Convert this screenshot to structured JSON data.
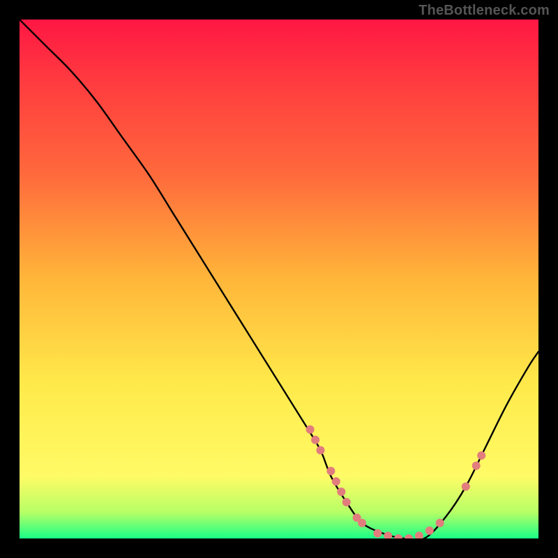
{
  "watermark": "TheBottleneck.com",
  "chart_data": {
    "type": "line",
    "title": "",
    "xlabel": "",
    "ylabel": "",
    "xlim": [
      0,
      100
    ],
    "ylim": [
      0,
      100
    ],
    "gradient_stops": [
      {
        "offset": 0.0,
        "color": "#ff1744"
      },
      {
        "offset": 0.12,
        "color": "#ff3b3f"
      },
      {
        "offset": 0.3,
        "color": "#ff6a3c"
      },
      {
        "offset": 0.5,
        "color": "#ffb63a"
      },
      {
        "offset": 0.7,
        "color": "#ffe94a"
      },
      {
        "offset": 0.88,
        "color": "#fffb66"
      },
      {
        "offset": 0.95,
        "color": "#b6ff66"
      },
      {
        "offset": 1.0,
        "color": "#19ff87"
      }
    ],
    "series": [
      {
        "name": "bottleneck-curve",
        "x": [
          0,
          5,
          10,
          15,
          20,
          25,
          30,
          35,
          40,
          45,
          50,
          55,
          58,
          60,
          63,
          66,
          70,
          74,
          78,
          82,
          86,
          90,
          94,
          98,
          100
        ],
        "y": [
          100,
          95,
          90,
          84,
          77,
          70,
          62,
          54,
          46,
          38,
          30,
          22,
          17,
          12,
          7,
          3,
          1,
          0,
          0,
          4,
          10,
          18,
          26,
          33,
          36
        ]
      }
    ],
    "highlight_points": {
      "name": "sample-dots",
      "color": "#e27d7d",
      "points": [
        {
          "x": 56,
          "y": 21
        },
        {
          "x": 57,
          "y": 19
        },
        {
          "x": 58,
          "y": 17
        },
        {
          "x": 60,
          "y": 13
        },
        {
          "x": 61,
          "y": 11
        },
        {
          "x": 62,
          "y": 9
        },
        {
          "x": 63,
          "y": 7
        },
        {
          "x": 65,
          "y": 4
        },
        {
          "x": 66,
          "y": 3
        },
        {
          "x": 69,
          "y": 1
        },
        {
          "x": 71,
          "y": 0.5
        },
        {
          "x": 73,
          "y": 0
        },
        {
          "x": 75,
          "y": 0
        },
        {
          "x": 77,
          "y": 0.5
        },
        {
          "x": 79,
          "y": 1.5
        },
        {
          "x": 81,
          "y": 3
        },
        {
          "x": 86,
          "y": 10
        },
        {
          "x": 88,
          "y": 14
        },
        {
          "x": 89,
          "y": 16
        }
      ]
    }
  }
}
